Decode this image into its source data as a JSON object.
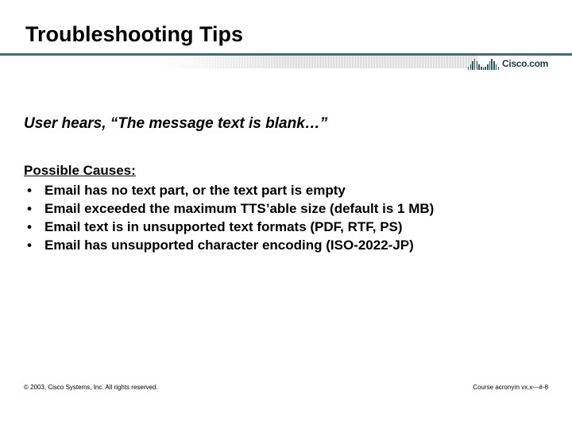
{
  "title": "Troubleshooting Tips",
  "logo_text": "Cisco.com",
  "scenario": "User hears, “The message text is blank…”",
  "causes_heading": "Possible Causes:",
  "bullets": [
    "Email has no text part, or the text part is empty",
    "Email exceeded the maximum TTS’able size (default is 1 MB)",
    "Email text is in unsupported text formats (PDF, RTF, PS)",
    "Email has unsupported character encoding (ISO-2022-JP)"
  ],
  "footer_left": "© 2003, Cisco Systems, Inc. All rights reserved.",
  "footer_right": "Course acronym vx.x—#-8"
}
